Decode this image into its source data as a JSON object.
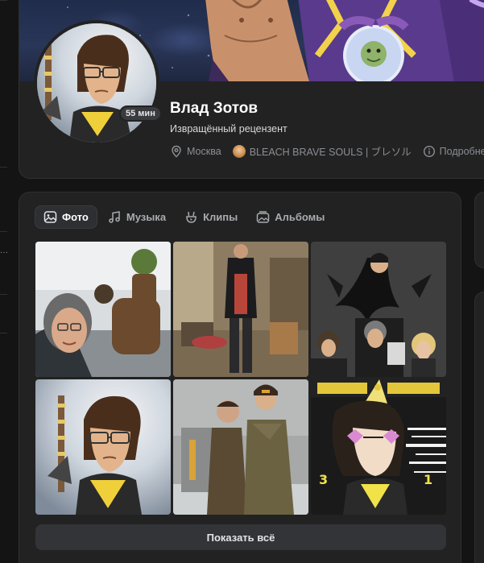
{
  "profile": {
    "name": "Влад Зотов",
    "status": "Извращённый рецензент",
    "online": "55 мин",
    "city": "Москва",
    "game": "BLEACH BRAVE SOULS | ブレソル",
    "details": "Подробне"
  },
  "media": {
    "tabs": [
      {
        "label": "Фото",
        "icon": "photo-icon",
        "active": true
      },
      {
        "label": "Музыка",
        "icon": "music-icon",
        "active": false
      },
      {
        "label": "Клипы",
        "icon": "clips-icon",
        "active": false
      },
      {
        "label": "Альбомы",
        "icon": "albums-icon",
        "active": false
      }
    ],
    "photos": [
      "selfie-with-shrek-statue",
      "man-in-leather-jacket-in-room",
      "cosplay-group-black-wings",
      "cartoon-avatar-portrait",
      "two-men-in-winter-coats",
      "anime-party-hat-artwork"
    ],
    "show_all": "Показать всё"
  },
  "colors": {
    "page_bg": "#141414",
    "card_bg": "#222222",
    "button_bg": "#333437",
    "text_primary": "#ffffff",
    "text_secondary": "#8b8e93"
  }
}
